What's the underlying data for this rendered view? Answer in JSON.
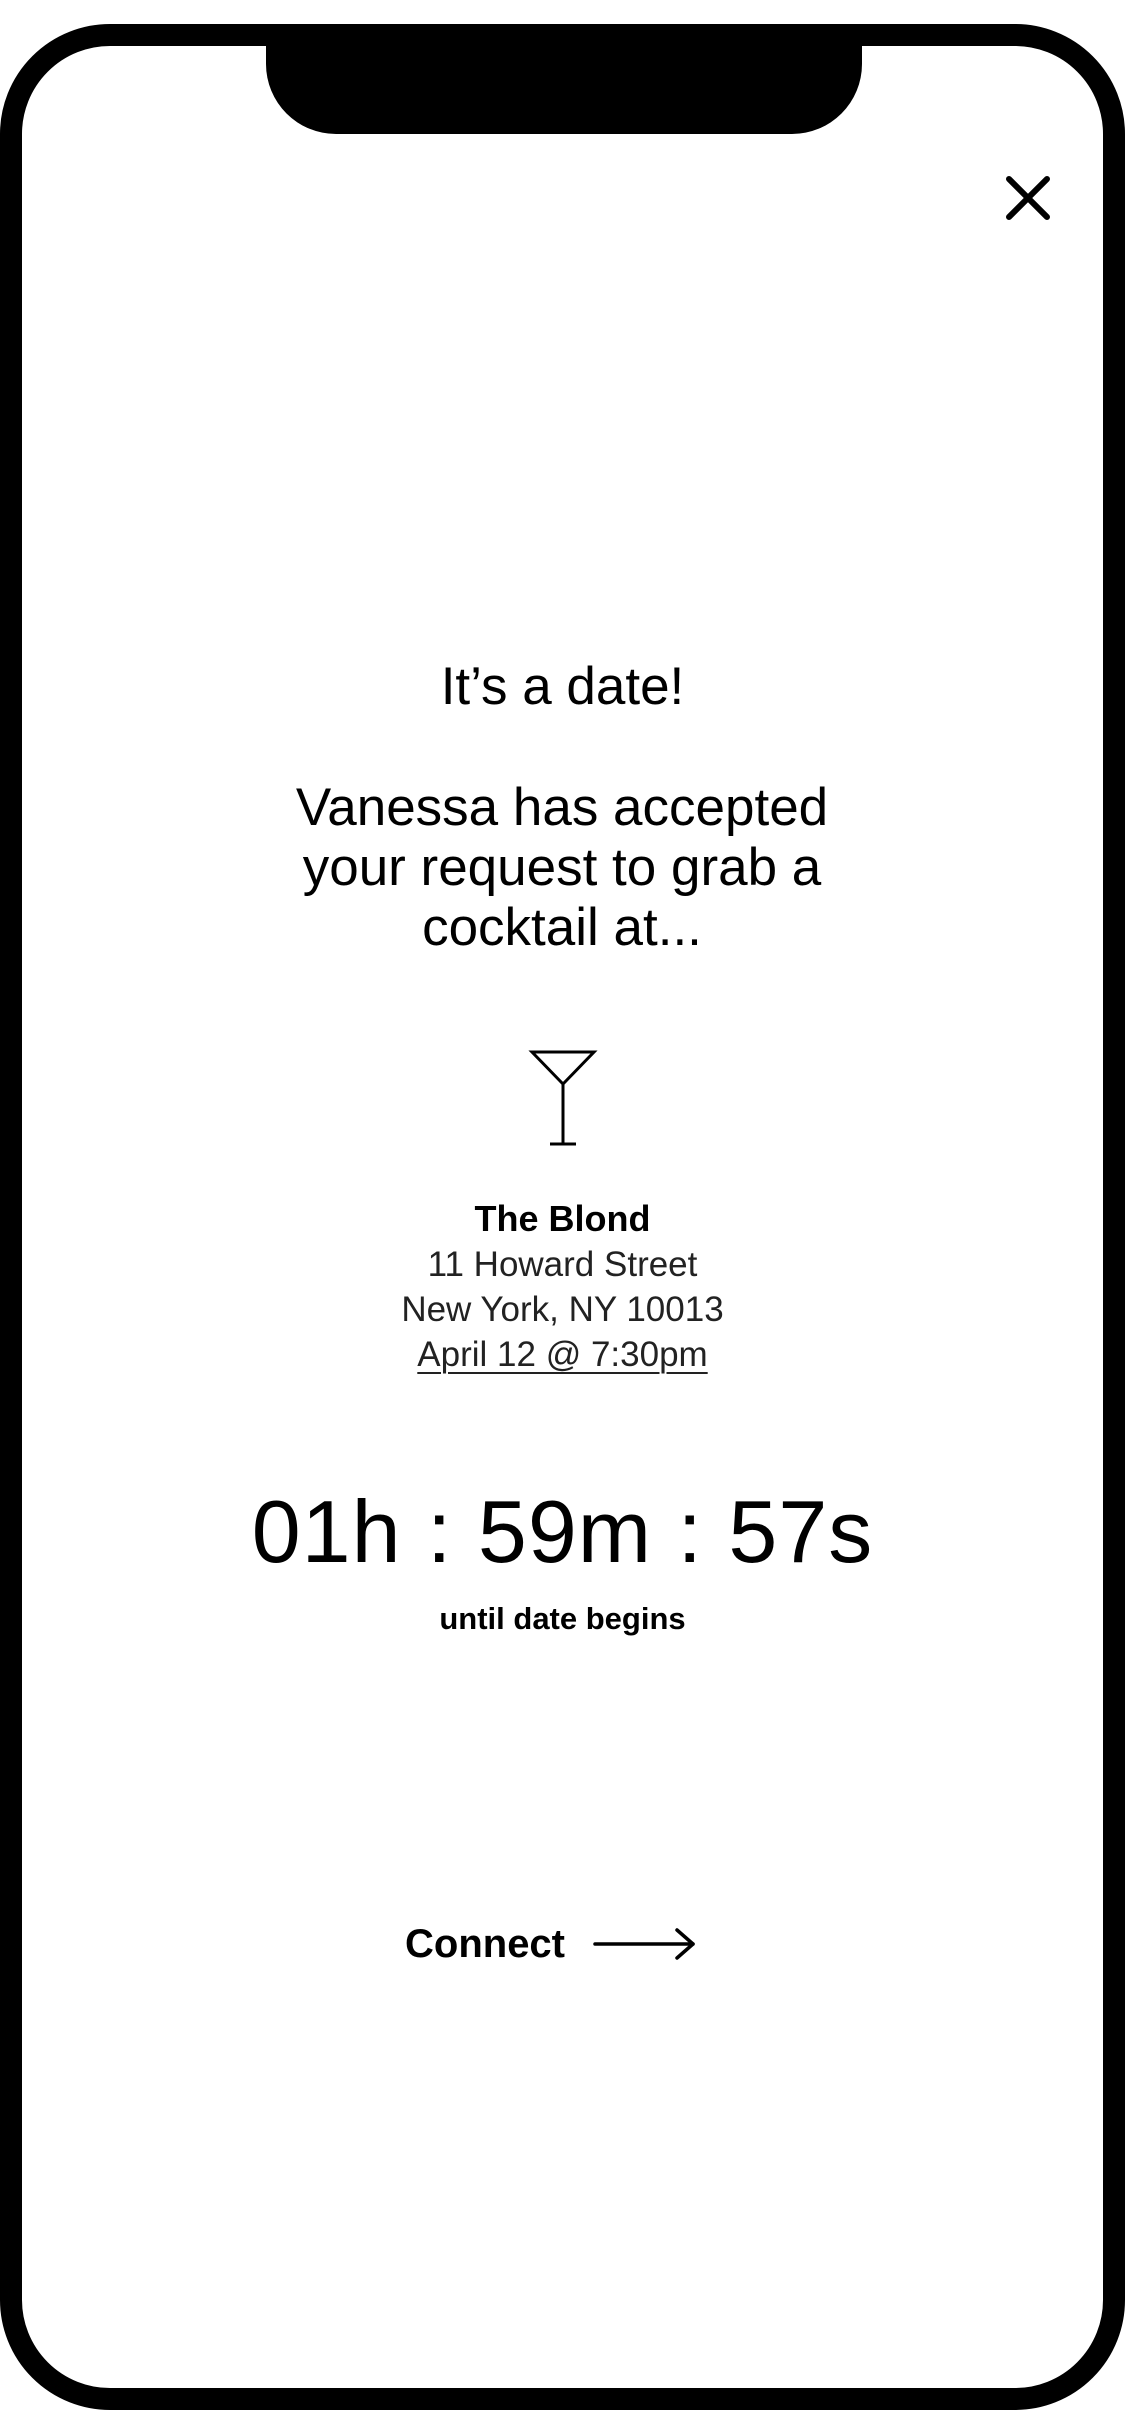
{
  "header": {
    "close_icon": "close-icon"
  },
  "main": {
    "headline": "It’s a date!",
    "message": "Vanessa has accepted your request to grab a cocktail at...",
    "venue_icon": "cocktail-glass-icon",
    "venue": {
      "name": "The Blond",
      "address_line1": "11 Howard Street",
      "address_line2": "New York, NY 10013",
      "datetime": "April 12 @ 7:30pm"
    },
    "countdown": {
      "value": "01h : 59m : 57s",
      "caption": "until date begins"
    },
    "connect": {
      "label": "Connect",
      "icon": "arrow-right-icon"
    }
  },
  "colors": {
    "text": "#000000",
    "background": "#ffffff",
    "frame": "#000000"
  }
}
